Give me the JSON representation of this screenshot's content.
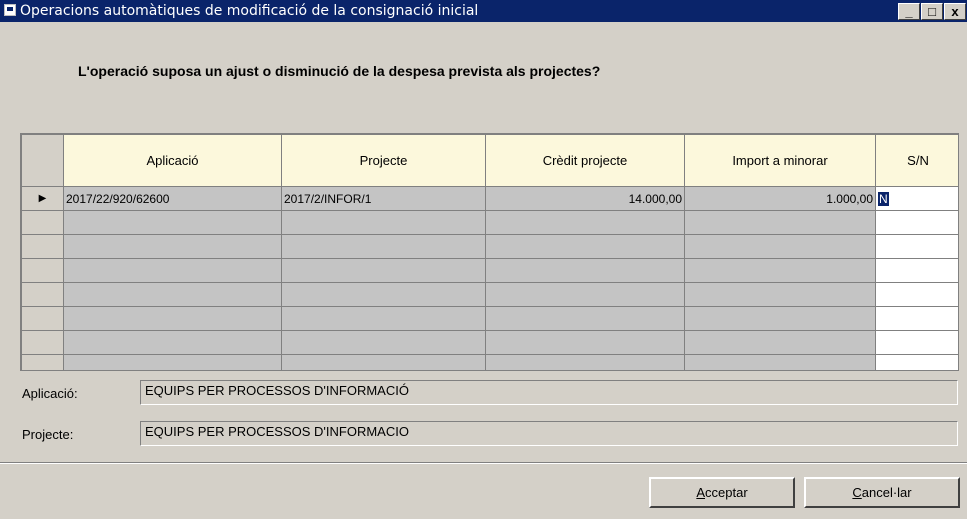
{
  "window": {
    "title": "Operacions automàtiques de modificació de la consignació inicial",
    "controls": [
      "_",
      "□",
      "x"
    ]
  },
  "question": "L'operació suposa un ajust o disminució de la despesa prevista als projectes?",
  "grid": {
    "columns": [
      "Aplicació",
      "Projecte",
      "Crèdit projecte",
      "Import a minorar",
      "S/N"
    ],
    "rows": [
      {
        "aplicacio": "2017/22/920/62600",
        "projecte": "2017/2/INFOR/1",
        "credit": "14.000,00",
        "import": "1.000,00",
        "sn": "N"
      }
    ],
    "empty_rows": 7
  },
  "details": {
    "aplicacio_label": "Aplicació:",
    "aplicacio_value": "EQUIPS PER PROCESSOS D'INFORMACIÓ",
    "projecte_label": "Projecte:",
    "projecte_value": "EQUIPS PER PROCESSOS D'INFORMACIO"
  },
  "buttons": {
    "accept_rest": "cceptar",
    "accept_mnemonic": "A",
    "cancel_rest": "ancel·lar",
    "cancel_mnemonic": "C"
  },
  "colors": {
    "titlebar": "#0a246a",
    "header_bg": "#fcf8dc",
    "cell_bg": "#c4c4c4",
    "face": "#d4d0c8"
  }
}
